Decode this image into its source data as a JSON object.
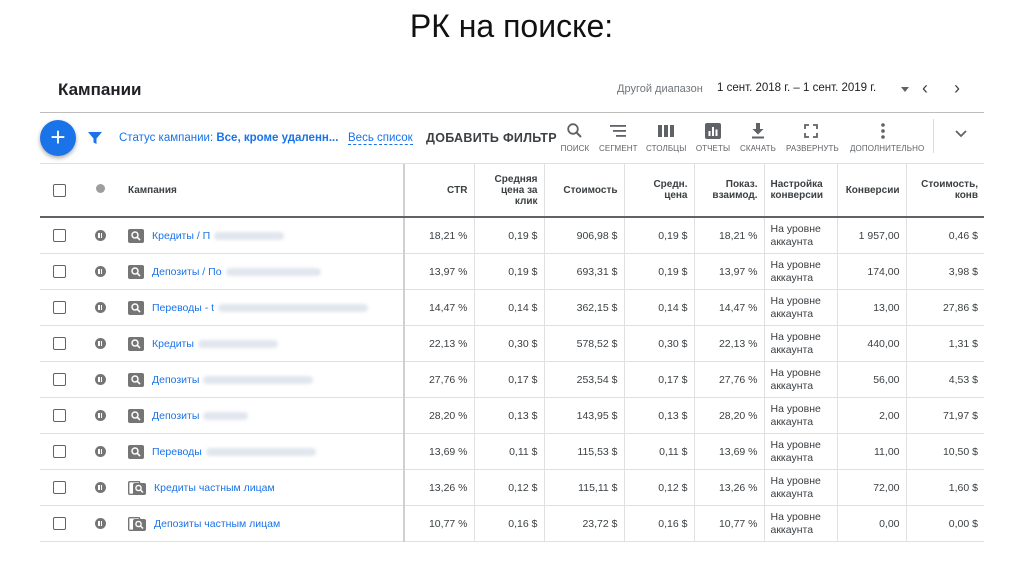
{
  "slide_title": "РК на поиске:",
  "header": {
    "title": "Кампании",
    "range_label": "Другой диапазон",
    "range_value": "1 сент. 2018 г. – 1 сент. 2019 г."
  },
  "toolbar": {
    "add_icon": "plus-icon",
    "status_label": "Статус кампании: ",
    "status_value": "Все, кроме удаленн...",
    "all_list": "Весь список",
    "add_filter": "ДОБАВИТЬ ФИЛЬТР",
    "tools": [
      {
        "label": "ПОИСК",
        "icon": "search-icon"
      },
      {
        "label": "СЕГМЕНТ",
        "icon": "segment-icon"
      },
      {
        "label": "СТОЛБЦЫ",
        "icon": "columns-icon"
      },
      {
        "label": "ОТЧЕТЫ",
        "icon": "reports-icon"
      },
      {
        "label": "СКАЧАТЬ",
        "icon": "download-icon"
      },
      {
        "label": "РАЗВЕРНУТЬ",
        "icon": "expand-icon"
      },
      {
        "label": "ДОПОЛНИТЕЛЬНО",
        "icon": "more-icon"
      }
    ]
  },
  "table": {
    "headers": {
      "campaign": "Кампания",
      "ctr": "CTR",
      "avg_cpc": "Средняя цена за клик",
      "cost": "Стоимость",
      "avg_price": "Средн. цена",
      "interaction_rate": "Показ. взаимод.",
      "conv_setting": "Настройка конверсии",
      "conversions": "Конверсии",
      "cost_per_conv": "Стоимость, конв"
    },
    "rows": [
      {
        "name": "Кредиты / П",
        "ctr": "18,21 %",
        "cpc": "0,19 $",
        "cost": "906,98 $",
        "avg": "0,19 $",
        "rate": "18,21 %",
        "conv_setting": "На уровне аккаунта",
        "conversions": "1 957,00",
        "cpa": "0,46 $",
        "type_icon": "search-campaign-icon"
      },
      {
        "name": "Депозиты / По",
        "ctr": "13,97 %",
        "cpc": "0,19 $",
        "cost": "693,31 $",
        "avg": "0,19 $",
        "rate": "13,97 %",
        "conv_setting": "На уровне аккаунта",
        "conversions": "174,00",
        "cpa": "3,98 $",
        "type_icon": "search-campaign-icon"
      },
      {
        "name": "Переводы - t",
        "ctr": "14,47 %",
        "cpc": "0,14 $",
        "cost": "362,15 $",
        "avg": "0,14 $",
        "rate": "14,47 %",
        "conv_setting": "На уровне аккаунта",
        "conversions": "13,00",
        "cpa": "27,86 $",
        "type_icon": "search-campaign-icon"
      },
      {
        "name": "Кредиты",
        "ctr": "22,13 %",
        "cpc": "0,30 $",
        "cost": "578,52 $",
        "avg": "0,30 $",
        "rate": "22,13 %",
        "conv_setting": "На уровне аккаунта",
        "conversions": "440,00",
        "cpa": "1,31 $",
        "type_icon": "search-campaign-icon"
      },
      {
        "name": "Депозиты",
        "ctr": "27,76 %",
        "cpc": "0,17 $",
        "cost": "253,54 $",
        "avg": "0,17 $",
        "rate": "27,76 %",
        "conv_setting": "На уровне аккаунта",
        "conversions": "56,00",
        "cpa": "4,53 $",
        "type_icon": "search-campaign-icon"
      },
      {
        "name": "Депозиты",
        "ctr": "28,20 %",
        "cpc": "0,13 $",
        "cost": "143,95 $",
        "avg": "0,13 $",
        "rate": "28,20 %",
        "conv_setting": "На уровне аккаунта",
        "conversions": "2,00",
        "cpa": "71,97 $",
        "type_icon": "search-campaign-icon"
      },
      {
        "name": "Переводы",
        "ctr": "13,69 %",
        "cpc": "0,11 $",
        "cost": "115,53 $",
        "avg": "0,11 $",
        "rate": "13,69 %",
        "conv_setting": "На уровне аккаунта",
        "conversions": "11,00",
        "cpa": "10,50 $",
        "type_icon": "search-campaign-icon"
      },
      {
        "name": "Кредиты частным лицам",
        "ctr": "13,26 %",
        "cpc": "0,12 $",
        "cost": "115,11 $",
        "avg": "0,12 $",
        "rate": "13,26 %",
        "conv_setting": "На уровне аккаунта",
        "conversions": "72,00",
        "cpa": "1,60 $",
        "type_icon": "dsa-campaign-icon"
      },
      {
        "name": "Депозиты частным лицам",
        "ctr": "10,77 %",
        "cpc": "0,16 $",
        "cost": "23,72 $",
        "avg": "0,16 $",
        "rate": "10,77 %",
        "conv_setting": "На уровне аккаунта",
        "conversions": "0,00",
        "cpa": "0,00 $",
        "type_icon": "dsa-campaign-icon"
      }
    ]
  }
}
